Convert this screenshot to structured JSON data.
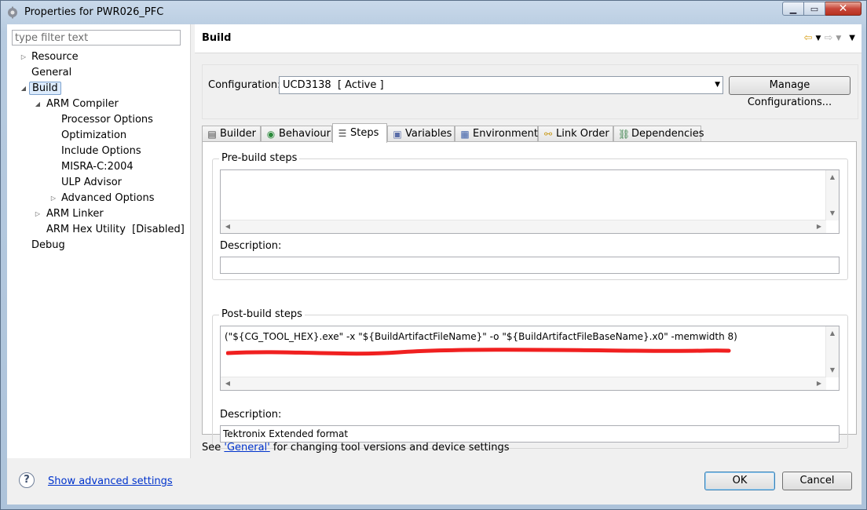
{
  "window": {
    "title": "Properties for PWR026_PFC"
  },
  "filter": {
    "placeholder": "type filter text"
  },
  "tree": {
    "resource": "Resource",
    "general": "General",
    "build": "Build",
    "arm_compiler": "ARM Compiler",
    "processor_options": "Processor Options",
    "optimization": "Optimization",
    "include_options": "Include Options",
    "misra": "MISRA-C:2004",
    "ulp_advisor": "ULP Advisor",
    "advanced_options": "Advanced Options",
    "arm_linker": "ARM Linker",
    "arm_hex_utility": "ARM Hex Utility  [Disabled]",
    "debug": "Debug"
  },
  "page": {
    "title": "Build"
  },
  "config": {
    "label": "Configuration:",
    "value": "UCD3138  [ Active ]",
    "manage_label": "Manage Configurations..."
  },
  "tabs": {
    "builder": "Builder",
    "behaviour": "Behaviour",
    "steps": "Steps",
    "variables": "Variables",
    "environment": "Environment",
    "link_order": "Link Order",
    "dependencies": "Dependencies"
  },
  "steps": {
    "prebuild_title": "Pre-build steps",
    "prebuild_command": "",
    "prebuild_desc_label": "Description:",
    "prebuild_desc_value": "",
    "postbuild_title": "Post-build steps",
    "postbuild_command": "(\"${CG_TOOL_HEX}.exe\" -x \"${BuildArtifactFileName}\" -o \"${BuildArtifactFileBaseName}.x0\" -memwidth 8)",
    "postbuild_desc_label": "Description:",
    "postbuild_desc_value": "Tektronix Extended format"
  },
  "footer": {
    "see": "See ",
    "link": "'General'",
    "rest": " for changing tool versions and device settings"
  },
  "bottom": {
    "advanced_link": "Show advanced settings",
    "ok": "OK",
    "cancel": "Cancel"
  },
  "colors": {
    "annotation_red": "#f02020",
    "link_blue": "#0033cc",
    "selection": "#dcebfc"
  }
}
